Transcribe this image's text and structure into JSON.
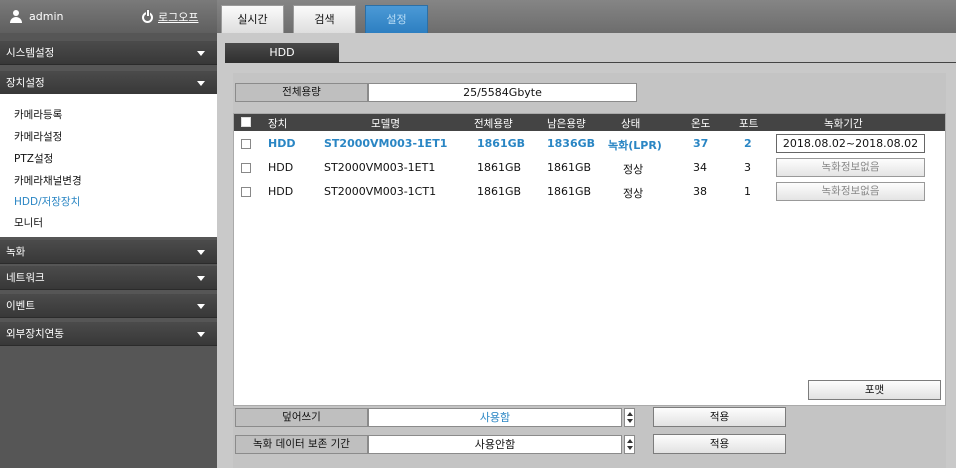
{
  "header": {
    "username": "admin",
    "logout_label": "로그오프",
    "tabs": [
      {
        "label": "실시간",
        "active": false
      },
      {
        "label": "검색",
        "active": false
      },
      {
        "label": "설정",
        "active": true
      }
    ]
  },
  "sidebar": {
    "menus": [
      {
        "label": "시스템설정"
      },
      {
        "label": "장치설정"
      },
      {
        "label": "녹화"
      },
      {
        "label": "네트워크"
      },
      {
        "label": "이벤트"
      },
      {
        "label": "외부장치연동"
      }
    ],
    "submenu": [
      {
        "label": "카메라등록"
      },
      {
        "label": "카메라설정"
      },
      {
        "label": "PTZ설정"
      },
      {
        "label": "카메라채널변경"
      },
      {
        "label": "HDD/저장장치",
        "active": true
      },
      {
        "label": "모니터"
      }
    ]
  },
  "main": {
    "section_title": "HDD",
    "capacity_label": "전체용량",
    "capacity_value": "25/5584Gbyte",
    "table": {
      "headers": [
        "장치",
        "모델명",
        "전체용량",
        "남은용량",
        "상태",
        "온도",
        "포트",
        "녹화기간"
      ],
      "rows": [
        {
          "device": "HDD",
          "model": "ST2000VM003-1ET1",
          "total": "1861GB",
          "free": "1836GB",
          "status": "녹화(LPR)",
          "temp": "37",
          "port": "2",
          "period": "2018.08.02~2018.08.02",
          "highlight": true
        },
        {
          "device": "HDD",
          "model": "ST2000VM003-1ET1",
          "total": "1861GB",
          "free": "1861GB",
          "status": "정상",
          "temp": "34",
          "port": "3",
          "period": "녹화정보없음",
          "highlight": false
        },
        {
          "device": "HDD",
          "model": "ST2000VM003-1CT1",
          "total": "1861GB",
          "free": "1861GB",
          "status": "정상",
          "temp": "38",
          "port": "1",
          "period": "녹화정보없음",
          "highlight": false
        }
      ]
    },
    "format_button": "포맷",
    "overwrite": {
      "label": "덮어쓰기",
      "value": "사용함",
      "apply": "적용"
    },
    "retention": {
      "label": "녹화 데이터 보존 기간",
      "value": "사용안함",
      "apply": "적용"
    }
  },
  "colors": {
    "accent": "#2a86c4",
    "active_tab": "#3a8ccb",
    "sidebar_header": "#3e3e3e"
  }
}
